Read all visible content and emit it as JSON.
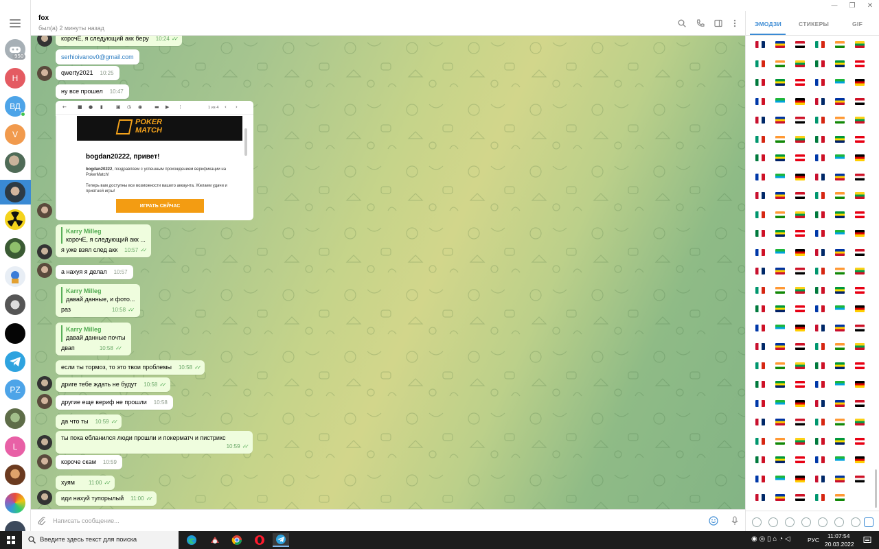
{
  "header": {
    "title": "fox",
    "status": "был(а) 2 минуты назад"
  },
  "composer": {
    "placeholder": "Написать сообщение..."
  },
  "strip": {
    "unread_badge": "950",
    "initials": [
      "Н",
      "ВД",
      "V",
      "PZ",
      "L"
    ]
  },
  "messages": [
    {
      "text": "корочЕ, я следующий акк беру",
      "time": "10:24"
    },
    {
      "link": "serhioivanov0@gmail.com"
    },
    {
      "text": "qwerty2021",
      "time": "10:25"
    },
    {
      "text": "ну все прошел",
      "time": "10:47"
    },
    {
      "reply_name": "Karry Milleg",
      "reply_text": "корочЕ, я следующий акк ...",
      "text": "я уже взял след акк",
      "time": "10:57"
    },
    {
      "text": "а нахуя я делал",
      "time": "10:57"
    },
    {
      "reply_name": "Karry Milleg",
      "reply_text": "давай данные, и фото...",
      "text": "раз",
      "time": "10:58"
    },
    {
      "reply_name": "Karry Milleg",
      "reply_text": "давай данные почты",
      "text": "двап",
      "time": "10:58"
    },
    {
      "text": "если ты тормоз, то это твои проблемы",
      "time": "10:58"
    },
    {
      "text": "дриге тебе ждать не будут",
      "time": "10:58"
    },
    {
      "text": "другие еще вериф не прошли",
      "time": "10:58"
    },
    {
      "text": "да что ты",
      "time": "10:59"
    },
    {
      "text": "ты пока ебланился люди прошли и покерматч и пистрикс",
      "time": "10:59"
    },
    {
      "text": "короче скам",
      "time": "10:59"
    },
    {
      "text": "хуям",
      "time": "11:00"
    },
    {
      "text": "иди нахуй тупорылый",
      "time": "11:00"
    }
  ],
  "image_message": {
    "page_counter": "1 из 4",
    "logo_line1": "POKER",
    "logo_line2": "MATCH",
    "greeting": "bogdan20222, привет!",
    "para1_user": "bogdan20222",
    "para1": ", поздравляем с успешным прохождением верификации на PokerMatch!",
    "para2": "Теперь вам доступны все возможности вашего аккаунта. Желаем удачи и приятной игры!",
    "button": "ИГРАТЬ СЕЙЧАС"
  },
  "panel": {
    "tabs": [
      "ЭМОДЗИ",
      "СТИКЕРЫ",
      "GIF"
    ]
  },
  "taskbar": {
    "search_placeholder": "Введите здесь текст для поиска",
    "lang": "РУС",
    "time": "11:07:54",
    "date": "20.03.2022"
  },
  "colors": {
    "accent": "#3a8ad4",
    "outgoing_bubble": "#effdde",
    "check": "#5aaf5a"
  }
}
